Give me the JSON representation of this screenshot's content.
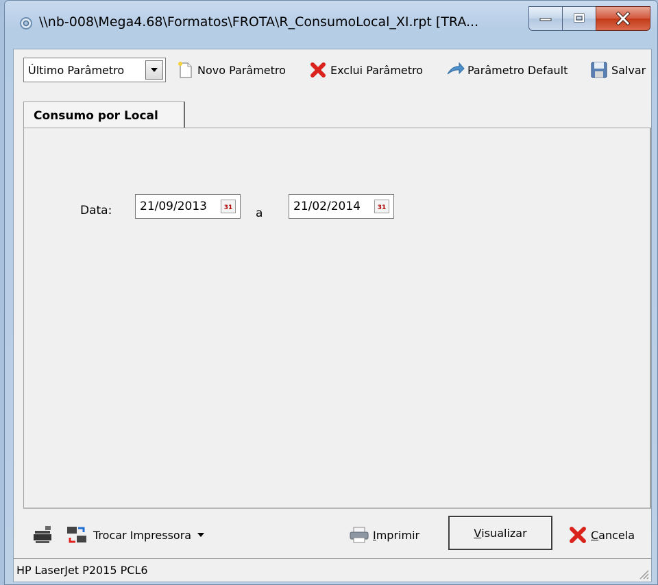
{
  "window": {
    "title": "\\\\nb-008\\Mega4.68\\Formatos\\FROTA\\R_ConsumoLocal_XI.rpt [TRA...",
    "controls": {
      "minimize": "minimize",
      "maximize": "maximize",
      "close": "close"
    }
  },
  "toolbar": {
    "param_select": {
      "value": "Último Parâmetro"
    },
    "new_param": "Novo Parâmetro",
    "delete_param": "Exclui Parâmetro",
    "default_param": "Parâmetro Default",
    "save": "Salvar"
  },
  "tabs": [
    {
      "label": "Consumo por Local",
      "active": true
    }
  ],
  "form": {
    "data_label": "Data:",
    "date_from": "21/09/2013",
    "range_sep": "a",
    "date_to": "21/02/2014",
    "calendar_glyph": "31"
  },
  "bottom": {
    "change_printer": "Trocar Impressora",
    "print_prefix": "I",
    "print_rest": "mprimir",
    "view_prefix": "V",
    "view_rest": "isualizar",
    "cancel_prefix": "C",
    "cancel_rest": "ancela"
  },
  "status": {
    "printer": "HP LaserJet P2015 PCL6"
  },
  "colors": {
    "titlebar": "#b9cfe7",
    "close_button": "#c94325",
    "client_bg": "#f0f0f0",
    "delete_icon": "#d9231c",
    "cancel_icon": "#d9231c"
  },
  "icons": {
    "app": "app-gear-icon",
    "new": "new-page-icon",
    "delete": "red-x-icon",
    "default": "arrow-icon",
    "save": "floppy-disk-icon",
    "printer_setup": "printer-setup-icon",
    "change_printer": "printer-swap-icon",
    "print": "printer-icon",
    "cancel": "red-x-icon",
    "grip": "resize-grip-icon"
  }
}
